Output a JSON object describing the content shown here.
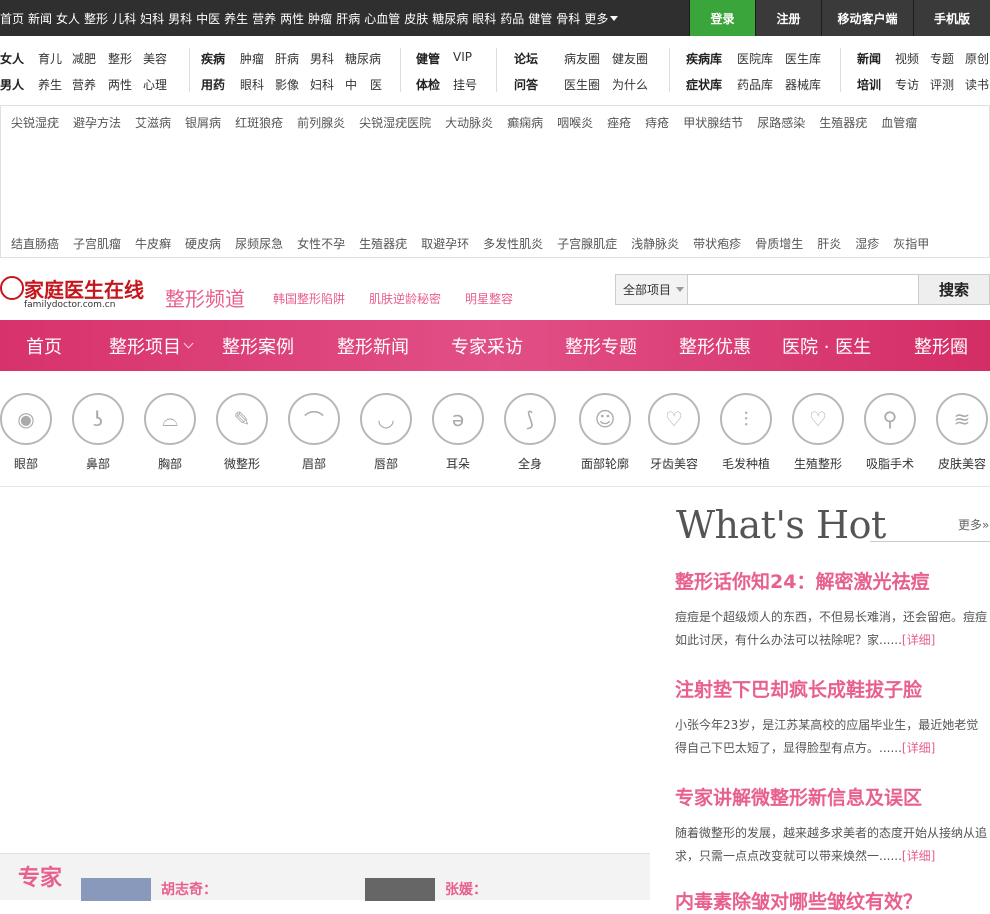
{
  "topnav": {
    "items": [
      "首页",
      "新闻",
      "女人",
      "整形",
      "儿科",
      "妇科",
      "男科",
      "中医",
      "养生",
      "营养",
      "两性",
      "肿瘤",
      "肝病",
      "心血管",
      "皮肤",
      "糖尿病",
      "眼科",
      "药品",
      "健管",
      "骨科"
    ],
    "more": "更多",
    "login": "登录",
    "register": "注册",
    "mobile_client": "移动客户端",
    "mobile_version": "手机版"
  },
  "categories": {
    "row1": [
      "女人",
      "育儿",
      "减肥",
      "整形",
      "美容",
      "疾病",
      "肿瘤",
      "肝病",
      "男科",
      "糖尿病",
      "健管",
      "VIP",
      "论坛",
      "病友圈",
      "健友圈",
      "疾病库",
      "医院库",
      "医生库",
      "新闻",
      "视频",
      "专题",
      "原创"
    ],
    "row2": [
      "男人",
      "养生",
      "营养",
      "两性",
      "心理",
      "用药",
      "眼科",
      "影像",
      "妇科",
      "中",
      "医",
      "体检",
      "挂号",
      "问答",
      "医生圈",
      "为什么",
      "症状库",
      "药品库",
      "器械库",
      "培训",
      "专访",
      "评测",
      "读书"
    ]
  },
  "tags": {
    "line1": [
      "尖锐湿疣",
      "避孕方法",
      "艾滋病",
      "银屑病",
      "红斑狼疮",
      "前列腺炎",
      "尖锐湿疣医院",
      "大动脉炎",
      "癫痫病",
      "咽喉炎",
      "痤疮",
      "痔疮",
      "甲状腺结节",
      "尿路感染",
      "生殖器疣",
      "血管瘤"
    ],
    "line2": [
      "结直肠癌",
      "子宫肌瘤",
      "牛皮癣",
      "硬皮病",
      "尿频尿急",
      "女性不孕",
      "生殖器疣",
      "取避孕环",
      "多发性肌炎",
      "子宫腺肌症",
      "浅静脉炎",
      "带状疱疹",
      "骨质增生",
      "肝炎",
      "湿疹",
      "灰指甲"
    ]
  },
  "logo": {
    "cn": "家庭医生在线",
    "en": "familydoctor.com.cn"
  },
  "channel": {
    "title": "整形频道",
    "links": [
      "韩国整形陷阱",
      "肌肤逆龄秘密",
      "明星整容"
    ]
  },
  "search": {
    "scope": "全部项目",
    "button": "搜索",
    "value": ""
  },
  "mainnav": {
    "items": [
      "首页",
      "整形项目",
      "整形案例",
      "整形新闻",
      "专家采访",
      "整形专题",
      "整形优惠",
      "医院 · 医生",
      "整形圈"
    ]
  },
  "parts": [
    {
      "label": "眼部",
      "icon": "eye-icon"
    },
    {
      "label": "鼻部",
      "icon": "nose-icon"
    },
    {
      "label": "胸部",
      "icon": "breast-icon"
    },
    {
      "label": "微整形",
      "icon": "syringe-icon"
    },
    {
      "label": "眉部",
      "icon": "eyebrow-icon"
    },
    {
      "label": "唇部",
      "icon": "lips-icon"
    },
    {
      "label": "耳朵",
      "icon": "ear-icon"
    },
    {
      "label": "全身",
      "icon": "body-icon"
    },
    {
      "label": "面部轮廓",
      "icon": "face-icon"
    },
    {
      "label": "牙齿美容",
      "icon": "tooth-icon"
    },
    {
      "label": "毛发种植",
      "icon": "hair-icon"
    },
    {
      "label": "生殖整形",
      "icon": "heart-icon"
    },
    {
      "label": "吸脂手术",
      "icon": "liposuction-icon"
    },
    {
      "label": "皮肤美容",
      "icon": "skin-icon"
    }
  ],
  "hot": {
    "title": "What's Hot",
    "more": "更多»",
    "articles": [
      {
        "title": "整形话你知24：解密激光祛痘",
        "desc": "痘痘是个超级烦人的东西，不但易长难消，还会留疤。痘痘如此讨厌，有什么办法可以祛除呢？家......",
        "detail": "[详细]"
      },
      {
        "title": "注射垫下巴却疯长成鞋拔子脸",
        "desc": "小张今年23岁，是江苏某高校的应届毕业生，最近她老觉得自己下巴太短了，显得脸型有点方。......",
        "detail": "[详细]"
      },
      {
        "title": "专家讲解微整形新信息及误区",
        "desc": "随着微整形的发展，越来越多求美者的态度开始从接纳从追求，只需一点点改变就可以带来焕然一......",
        "detail": "[详细]"
      },
      {
        "title": "内毒素除皱对哪些皱纹有效？",
        "desc": "",
        "detail": ""
      }
    ]
  },
  "experts": {
    "tag": "专家",
    "people": [
      {
        "name": "胡志奇："
      },
      {
        "name": "张媛："
      }
    ]
  },
  "colors": {
    "pink": "#e8608f",
    "nav_pink": "#d8326b",
    "topbar": "#2f2f2f",
    "login_green": "#3aa53a"
  }
}
